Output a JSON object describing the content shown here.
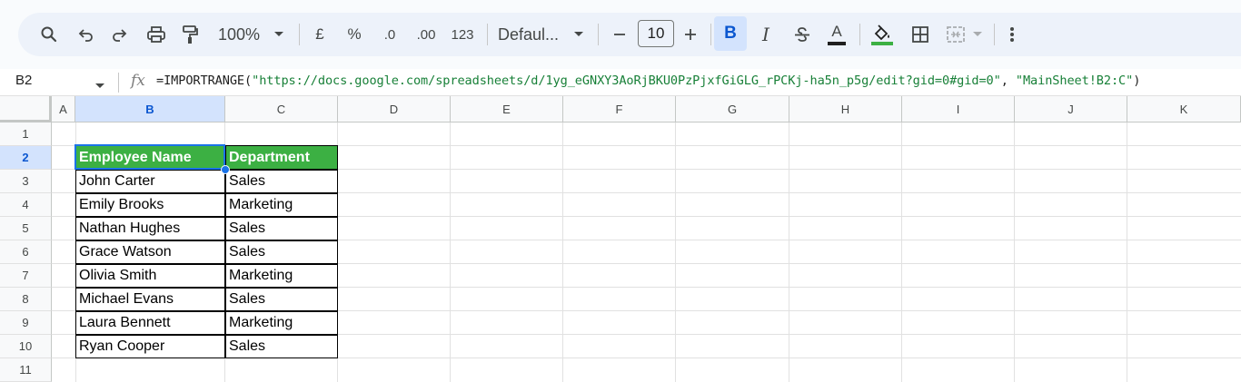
{
  "toolbar": {
    "zoom": "100%",
    "currency": "£",
    "percent": "%",
    "dec_decrease": ".0",
    "dec_increase": ".00",
    "number_format": "123",
    "font": "Defaul...",
    "font_size": "10",
    "bold": "B",
    "italic": "I",
    "text_color": "A",
    "fill_color": "#3cb043",
    "bold_active_color": "#d3e3fd"
  },
  "formula_bar": {
    "cell_ref": "B2",
    "fx": "fx",
    "formula_prefix": "=IMPORTRANGE(",
    "formula_url": "\"https://docs.google.com/spreadsheets/d/1yg_eGNXY3AoRjBKU0PzPjxfGiGLG_rPCKj-ha5n_p5g/edit?gid=0#gid=0\"",
    "formula_sep": ", ",
    "formula_range": "\"MainSheet!B2:C\"",
    "formula_suffix": ")"
  },
  "columns": [
    "A",
    "B",
    "C",
    "D",
    "E",
    "F",
    "G",
    "H",
    "I",
    "J",
    "K"
  ],
  "rows": [
    "1",
    "2",
    "3",
    "4",
    "5",
    "6",
    "7",
    "8",
    "9",
    "10",
    "11"
  ],
  "table": {
    "headers": [
      "Employee Name",
      "Department"
    ],
    "rows": [
      [
        "John Carter",
        "Sales"
      ],
      [
        "Emily Brooks",
        "Marketing"
      ],
      [
        "Nathan Hughes",
        "Sales"
      ],
      [
        "Grace Watson",
        "Sales"
      ],
      [
        "Olivia Smith",
        "Marketing"
      ],
      [
        "Michael Evans",
        "Sales"
      ],
      [
        "Laura Bennett",
        "Marketing"
      ],
      [
        "Ryan Cooper",
        "Sales"
      ]
    ]
  }
}
